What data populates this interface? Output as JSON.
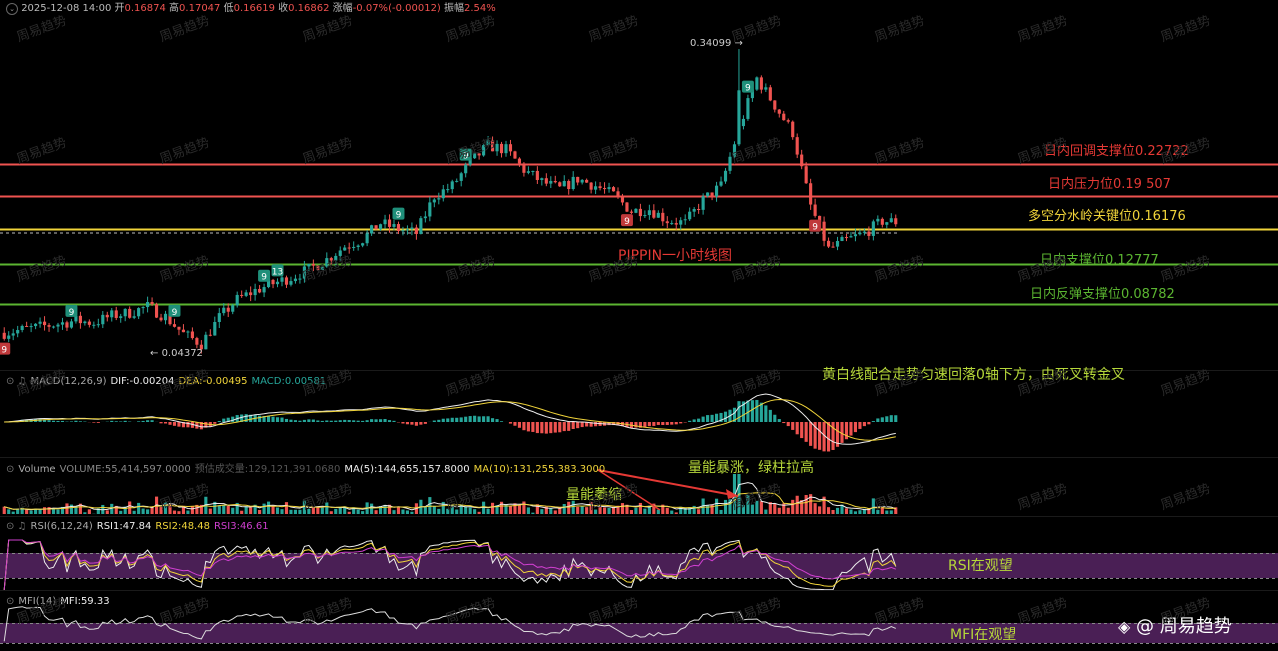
{
  "ohlc_bar": {
    "datetime": "2025-12-08 14:00",
    "open_label": "开",
    "open": "0.16874",
    "high_label": "高",
    "high": "0.17047",
    "low_label": "低",
    "low": "0.16619",
    "close_label": "收",
    "close": "0.16862",
    "change_label": "涨幅",
    "change": "-0.07%(-0.00012)",
    "amplitude_label": "振幅",
    "amplitude": "2.54%"
  },
  "main_title": "PIPPIN一小时线图",
  "price_marks": {
    "high": "0.34099",
    "low": "0.04372"
  },
  "levels": [
    {
      "label": "日内回调支撑位0.22722",
      "color": "#e53935"
    },
    {
      "label": "日内压力位0.19 507",
      "color": "#e53935"
    },
    {
      "label": "多空分水岭关键位0.16176",
      "color": "#f0d43a"
    },
    {
      "label": "日内支撑位0.12777",
      "color": "#5bb531"
    },
    {
      "label": "日内反弹支撑位0.08782",
      "color": "#5bb531"
    }
  ],
  "td_markers": [
    "9",
    "9",
    "9",
    "9",
    "13",
    "9",
    "9",
    "9",
    "9",
    "9"
  ],
  "macd": {
    "name": "MACD(12,26,9)",
    "dif": "DIF:-0.00204",
    "dea": "DEA:-0.00495",
    "macd": "MACD:0.00581",
    "comment": "黄白线配合走势匀速回落0轴下方，由死叉转金叉"
  },
  "volume": {
    "name": "Volume",
    "volume": "VOLUME:55,414,597.0000",
    "est": "预估成交量:129,121,391.0680",
    "ma5": "MA(5):144,655,157.8000",
    "ma10": "MA(10):131,255,383.3000",
    "note_shrink": "量能萎缩",
    "note_surge": "量能暴涨，绿柱拉高"
  },
  "rsi": {
    "name": "RSI(6,12,24)",
    "rsi1": "RSI1:47.84",
    "rsi2": "RSI2:48.48",
    "rsi3": "RSI3:46.61",
    "comment": "RSI在观望"
  },
  "mfi": {
    "name": "MFI(14)",
    "mfi": "MFI:59.33",
    "comment": "MFI在观望"
  },
  "watermark": "周易趋势",
  "brand": "@ 周易趋势",
  "colors": {
    "up": "#26a69a",
    "down": "#ef5350",
    "yellow": "#f0d43a",
    "magenta": "#d03fd0",
    "band": "#4a1f55"
  },
  "chart_data": {
    "type": "line",
    "title": "PIPPIN一小时线图",
    "x": [
      0,
      4,
      8,
      12,
      16,
      20,
      24,
      28,
      32,
      36,
      40,
      44,
      48,
      52,
      56,
      60,
      64,
      68,
      72,
      76,
      80,
      84,
      88,
      92,
      96,
      100,
      104,
      108,
      112,
      116,
      120,
      124,
      128,
      132,
      136,
      140,
      144,
      148,
      152,
      156,
      160,
      164,
      168,
      172,
      176,
      180,
      184,
      188,
      192,
      196,
      200
    ],
    "close": [
      0.059,
      0.062,
      0.065,
      0.068,
      0.071,
      0.069,
      0.076,
      0.079,
      0.085,
      0.075,
      0.058,
      0.048,
      0.074,
      0.092,
      0.101,
      0.108,
      0.114,
      0.122,
      0.132,
      0.145,
      0.152,
      0.168,
      0.162,
      0.158,
      0.195,
      0.205,
      0.228,
      0.245,
      0.241,
      0.221,
      0.209,
      0.202,
      0.212,
      0.205,
      0.196,
      0.18,
      0.182,
      0.171,
      0.168,
      0.191,
      0.205,
      0.262,
      0.312,
      0.285,
      0.258,
      0.185,
      0.142,
      0.151,
      0.158,
      0.17,
      0.169
    ],
    "high_mark": 0.34099,
    "low_mark": 0.04372,
    "levels": [
      0.22722,
      0.19507,
      0.16176,
      0.12777,
      0.08782
    ],
    "ylim": [
      0.03,
      0.35
    ]
  }
}
